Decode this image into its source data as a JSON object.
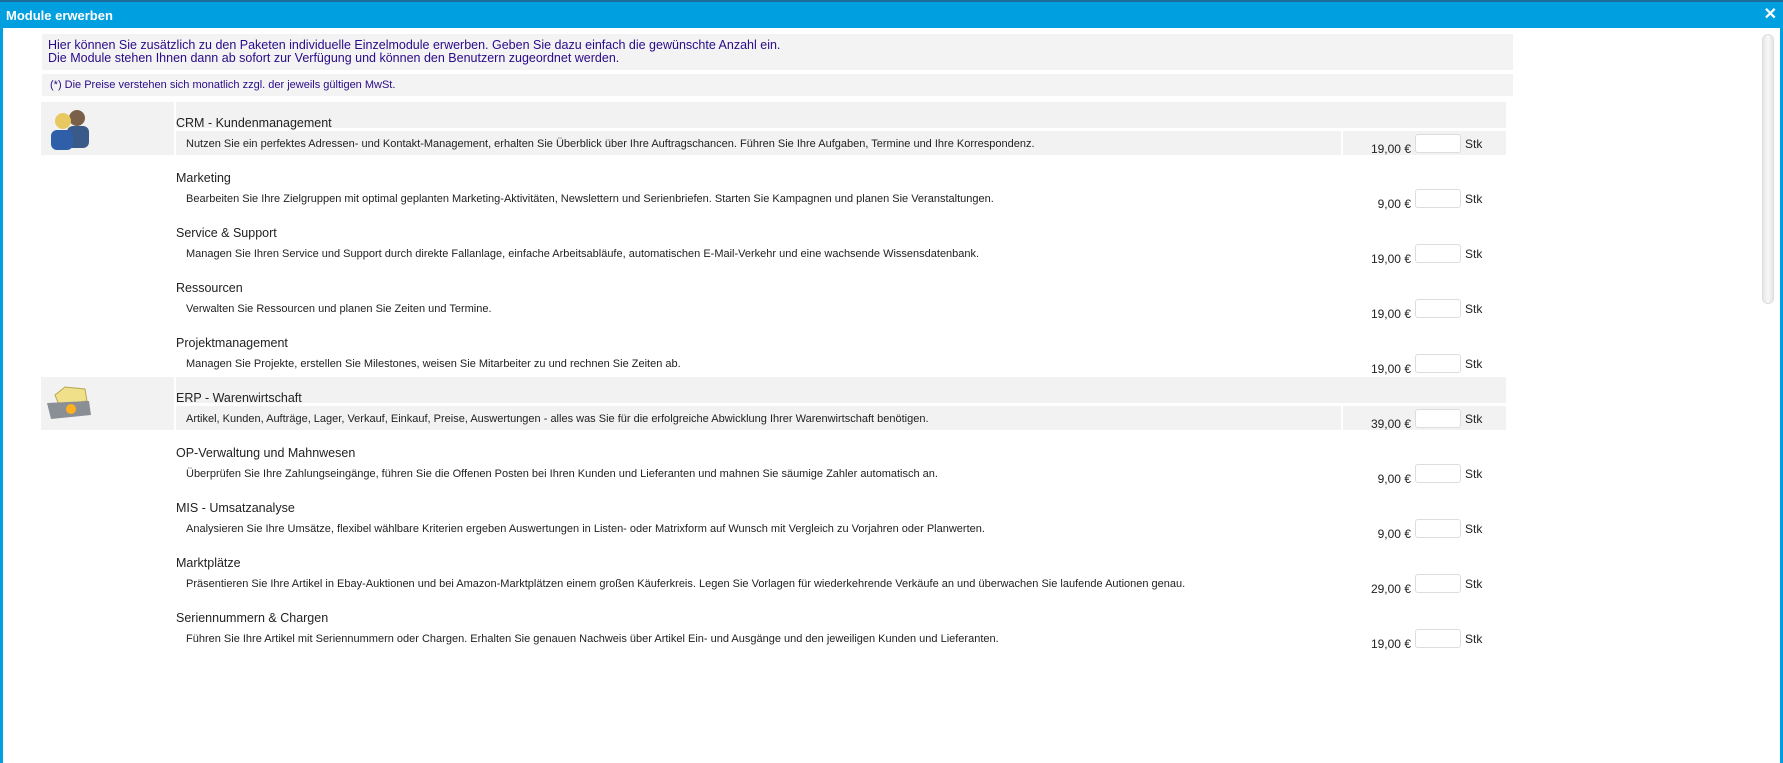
{
  "window": {
    "title": "Module erwerben",
    "close_icon": "close-icon"
  },
  "info": {
    "line1": "Hier können Sie zusätzlich zu den Paketen individuelle Einzelmodule erwerben. Geben Sie dazu einfach die gewünschte Anzahl ein.",
    "line2": "Die Module stehen Ihnen dann ab sofort zur Verfügung und können den Benutzern zugeordnet werden.",
    "note": "(*) Die Preise verstehen sich monatlich zzgl. der jeweils gültigen MwSt."
  },
  "unit_label": "Stk",
  "modules": [
    {
      "title": "CRM - Kundenmanagement",
      "desc": "Nutzen Sie ein perfektes Adressen- und Kontakt-Management, erhalten Sie Überblick über Ihre Auftragschancen. Führen Sie Ihre Aufgaben, Termine und Ihre Korrespondenz.",
      "price": "19,00 €",
      "package": true,
      "icon": "people-icon"
    },
    {
      "title": "Marketing",
      "desc": "Bearbeiten Sie Ihre Zielgruppen mit optimal geplanten Marketing-Aktivitäten, Newslettern und Serienbriefen. Starten Sie Kampagnen und planen Sie Veranstaltungen.",
      "price": "9,00 €"
    },
    {
      "title": "Service & Support",
      "desc": "Managen Sie Ihren Service und Support durch direkte Fallanlage, einfache Arbeitsabläufe, automatischen E-Mail-Verkehr und eine wachsende Wissensdatenbank.",
      "price": "19,00 €"
    },
    {
      "title": "Ressourcen",
      "desc": "Verwalten Sie Ressourcen und planen Sie Zeiten und Termine.",
      "price": "19,00 €"
    },
    {
      "title": "Projektmanagement",
      "desc": "Managen Sie Projekte, erstellen Sie Milestones, weisen Sie Mitarbeiter zu und rechnen Sie Zeiten ab.",
      "price": "19,00 €"
    },
    {
      "title": "ERP - Warenwirtschaft",
      "desc": "Artikel, Kunden, Aufträge, Lager, Verkauf, Einkauf, Preise, Auswertungen - alles was Sie für die erfolgreiche Abwicklung Ihrer Warenwirtschaft benötigen.",
      "price": "39,00 €",
      "package": true,
      "icon": "box-icon"
    },
    {
      "title": "OP-Verwaltung und Mahnwesen",
      "desc": "Überprüfen Sie Ihre Zahlungseingänge, führen Sie die Offenen Posten bei Ihren Kunden und Lieferanten und mahnen Sie säumige Zahler automatisch an.",
      "price": "9,00 €"
    },
    {
      "title": "MIS - Umsatzanalyse",
      "desc": "Analysieren Sie Ihre Umsätze, flexibel wählbare Kriterien ergeben Auswertungen in Listen- oder Matrixform auf Wunsch mit Vergleich zu Vorjahren oder Planwerten.",
      "price": "9,00 €"
    },
    {
      "title": "Marktplätze",
      "desc": "Präsentieren Sie Ihre Artikel in Ebay-Auktionen und bei Amazon-Marktplätzen einem großen Käuferkreis. Legen Sie Vorlagen für wiederkehrende Verkäufe an und überwachen Sie laufende Autionen genau.",
      "price": "29,00 €"
    },
    {
      "title": "Seriennummern & Chargen",
      "desc": "Führen Sie Ihre Artikel mit Seriennummern oder Chargen. Erhalten Sie genauen Nachweis über Artikel Ein- und Ausgänge und den jeweiligen Kunden und Lieferanten.",
      "price": "19,00 €"
    }
  ]
}
